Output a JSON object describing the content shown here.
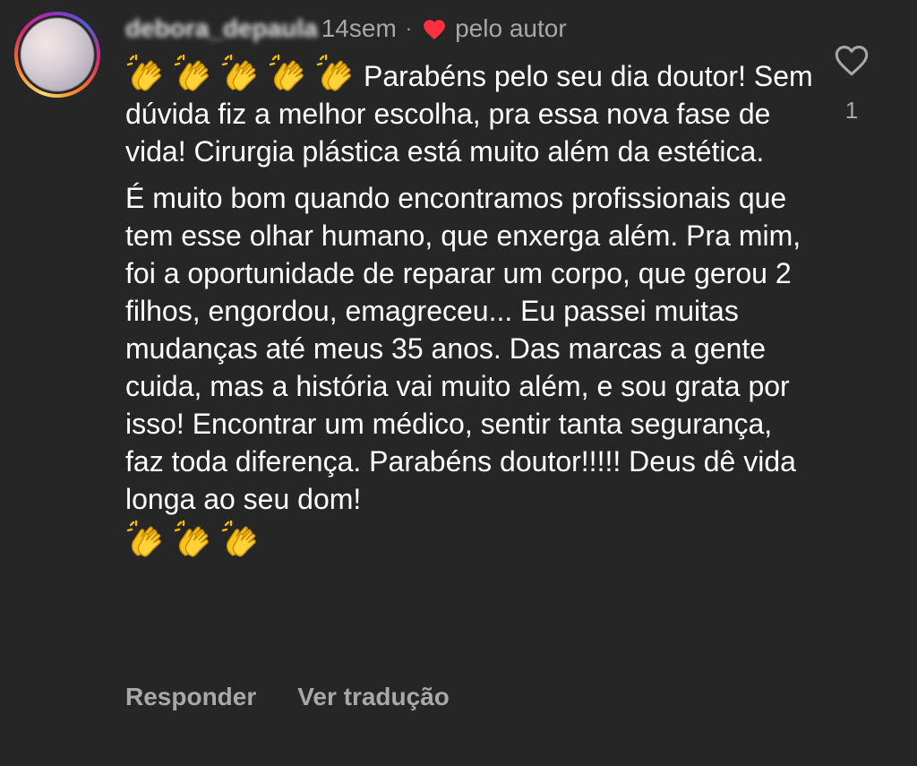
{
  "comment": {
    "username": "debora_depaula",
    "time": "14sem",
    "separator": "·",
    "liked_by_author_label": "pelo autor",
    "text_paragraph_1": "Parabéns pelo seu dia doutor! Sem dúvida fiz a melhor escolha, pra essa nova fase de vida! Cirurgia plástica está muito além da estética.",
    "text_paragraph_2": "É muito bom quando encontramos profissionais que tem esse olhar humano, que enxerga além. Pra mim, foi a oportunidade de reparar um corpo, que gerou 2 filhos, engordou, emagreceu... Eu passei muitas mudanças até meus 35 anos. Das marcas a gente cuida, mas a história vai muito além, e sou grata por isso! Encontrar um médico, sentir tanta segurança, faz toda diferença. Parabéns doutor!!!!! Deus dê vida longa ao seu dom!",
    "leading_emoji_count": 5,
    "trailing_emoji_count": 3,
    "emoji_icon": "clapping-hands-icon",
    "like_count": "1",
    "actions": {
      "reply": "Responder",
      "translate": "Ver tradução"
    }
  },
  "colors": {
    "background": "#262626",
    "text": "#ffffff",
    "secondary_text": "#a8a8a8",
    "heart_red": "#ff3040"
  }
}
